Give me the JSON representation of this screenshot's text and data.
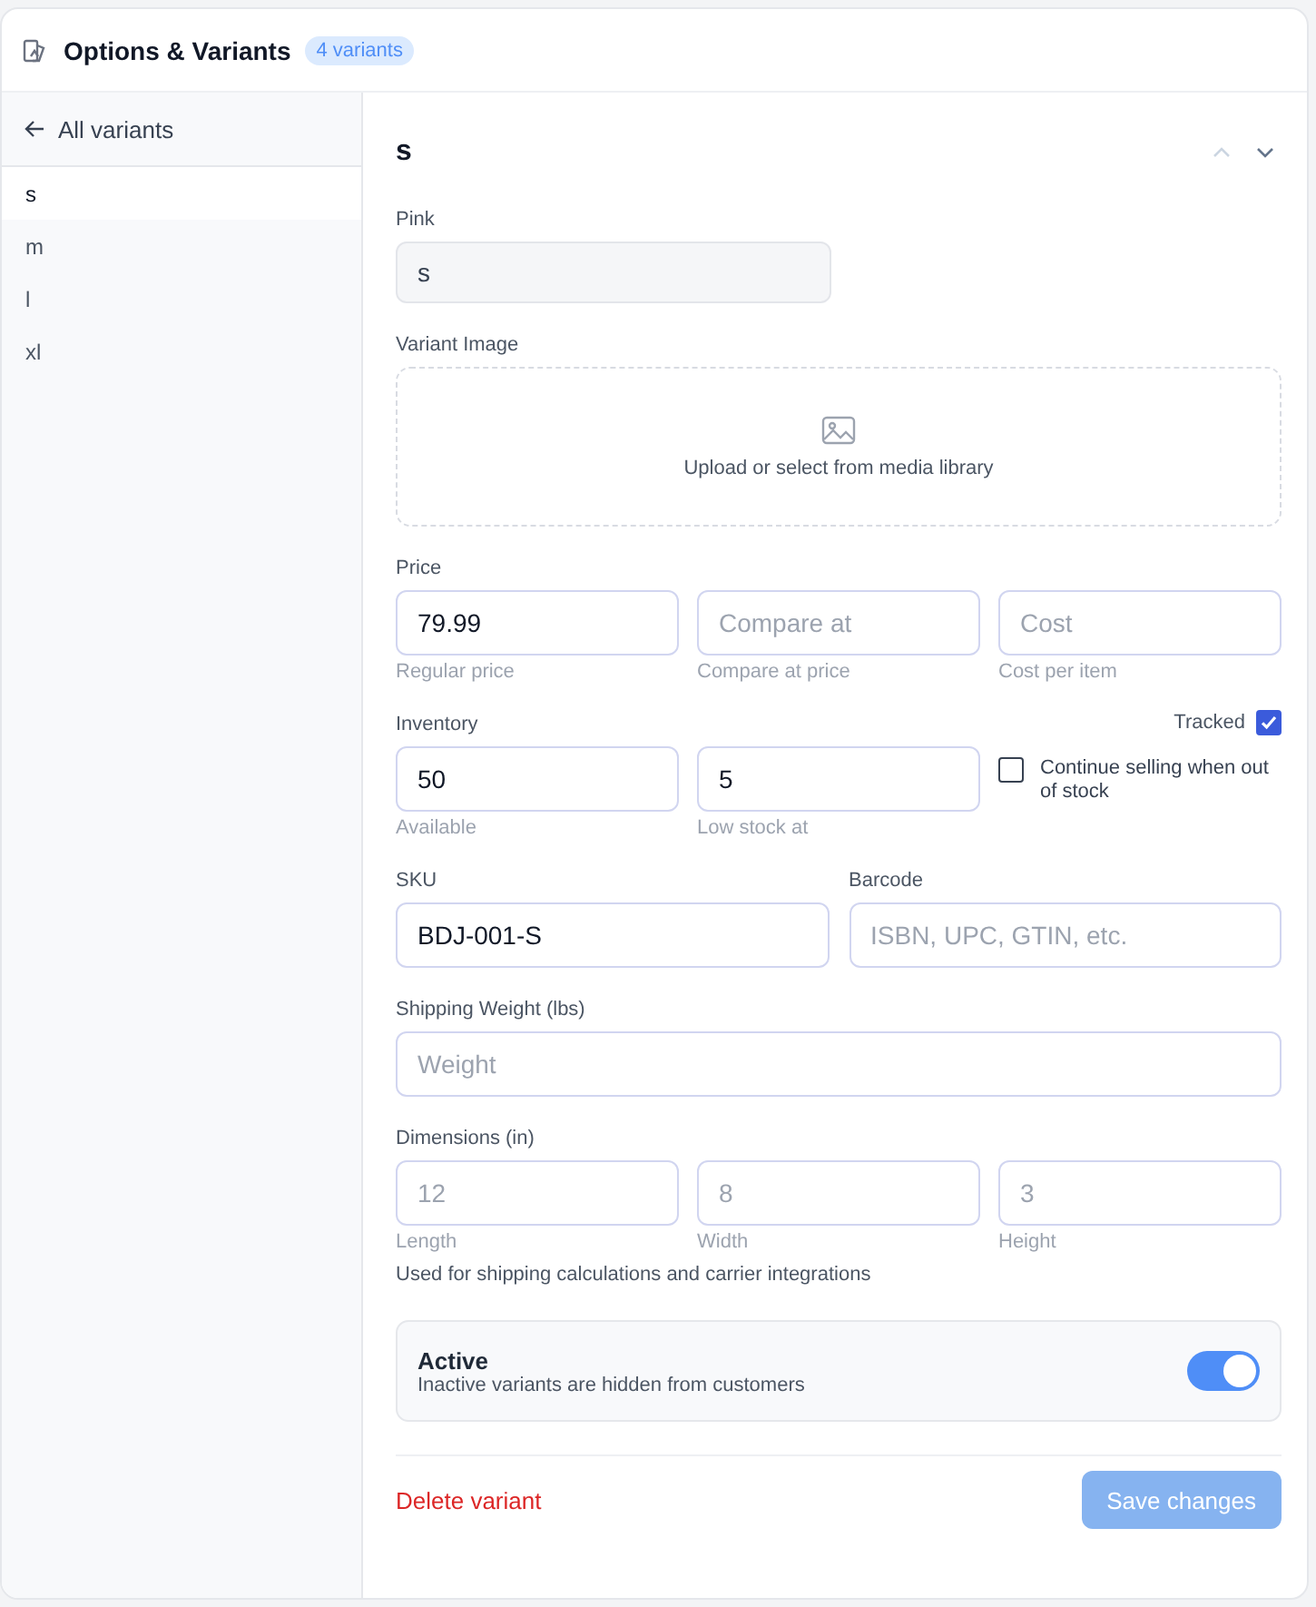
{
  "header": {
    "title": "Options & Variants",
    "badge": "4 variants"
  },
  "sidebar": {
    "back": "All variants",
    "items": [
      {
        "label": "s",
        "selected": true
      },
      {
        "label": "m",
        "selected": false
      },
      {
        "label": "l",
        "selected": false
      },
      {
        "label": "xl",
        "selected": false
      }
    ]
  },
  "variant": {
    "title": "s",
    "nav": [
      {
        "kind": "up",
        "disabled": true
      },
      {
        "kind": "down",
        "disabled": false
      }
    ]
  },
  "option": {
    "label": "Pink",
    "value": "s",
    "disabled": true
  },
  "image": {
    "label": "Variant Image",
    "text": "Upload or select from media library"
  },
  "price": {
    "label": "Price",
    "fields": [
      {
        "value": "79.99",
        "hint": "Regular price"
      },
      {
        "placeholder": "Compare at",
        "hint": "Compare at price"
      },
      {
        "placeholder": "Cost",
        "hint": "Cost per item"
      }
    ]
  },
  "inventory": {
    "label": "Inventory",
    "tracked": {
      "label": "Tracked",
      "checked": true
    },
    "fields": [
      {
        "value": "50",
        "hint": "Available"
      },
      {
        "value": "5",
        "hint": "Low stock at"
      }
    ],
    "continue_selling": {
      "label": "Continue selling when out of stock",
      "checked": false
    }
  },
  "sku": {
    "label": "SKU",
    "value": "BDJ-001-S"
  },
  "barcode": {
    "label": "Barcode",
    "placeholder": "ISBN, UPC, GTIN, etc."
  },
  "shipping_weight": {
    "label": "Shipping Weight (lbs)",
    "placeholder": "Weight"
  },
  "dimensions": {
    "label": "Dimensions (in)",
    "fields": [
      {
        "placeholder": "12",
        "hint": "Length"
      },
      {
        "placeholder": "8",
        "hint": "Width"
      },
      {
        "placeholder": "3",
        "hint": "Height"
      }
    ],
    "note": "Used for shipping calculations and carrier integrations"
  },
  "active": {
    "title": "Active",
    "description": "Inactive variants are hidden from customers",
    "on": true
  },
  "footer": {
    "delete": "Delete variant",
    "save": {
      "label": "Save changes",
      "disabled": true
    }
  }
}
